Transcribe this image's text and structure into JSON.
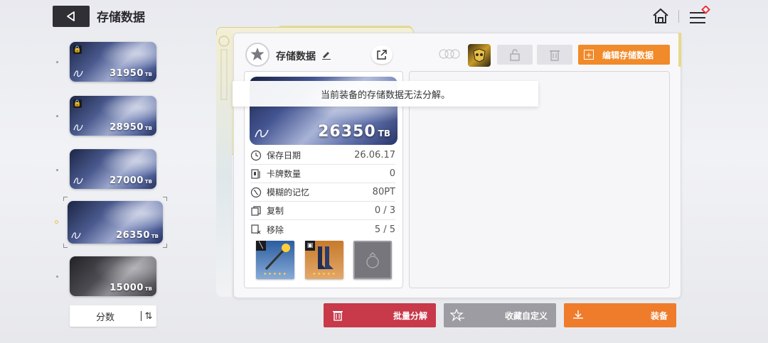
{
  "header": {
    "title": "存储数据"
  },
  "list": {
    "cards": [
      {
        "value": "31950",
        "unit": "TB",
        "locked": true,
        "style": "blue"
      },
      {
        "value": "28950",
        "unit": "TB",
        "locked": true,
        "style": "blue"
      },
      {
        "value": "27000",
        "unit": "TB",
        "locked": false,
        "style": "blue"
      },
      {
        "value": "26350",
        "unit": "TB",
        "locked": false,
        "style": "blue",
        "selected": true
      },
      {
        "value": "15000",
        "unit": "TB",
        "locked": false,
        "style": "dark"
      }
    ],
    "sort_label": "分数"
  },
  "panel": {
    "title": "存储数据",
    "edit_label": "编辑存储数据",
    "card": {
      "value": "26350",
      "unit": "TB"
    },
    "stats": [
      {
        "label": "保存日期",
        "value": "26.06.17",
        "icon": "clock-icon"
      },
      {
        "label": "卡牌数量",
        "value": "0",
        "icon": "card-icon"
      },
      {
        "label": "模糊的记忆",
        "value": "80PT",
        "icon": "memory-icon"
      },
      {
        "label": "复制",
        "value": "0 / 3",
        "icon": "copy-icon"
      },
      {
        "label": "移除",
        "value": "5 / 5",
        "icon": "remove-icon"
      }
    ]
  },
  "toast": {
    "message": "当前装备的存储数据无法分解。"
  },
  "actions": {
    "dismantle_label": "批量分解",
    "custom_label": "收藏自定义",
    "equip_label": "装备"
  },
  "colors": {
    "accent_orange": "#ef7c2a",
    "danger_red": "#c8394a",
    "neutral_gray": "#9c9ca2"
  }
}
